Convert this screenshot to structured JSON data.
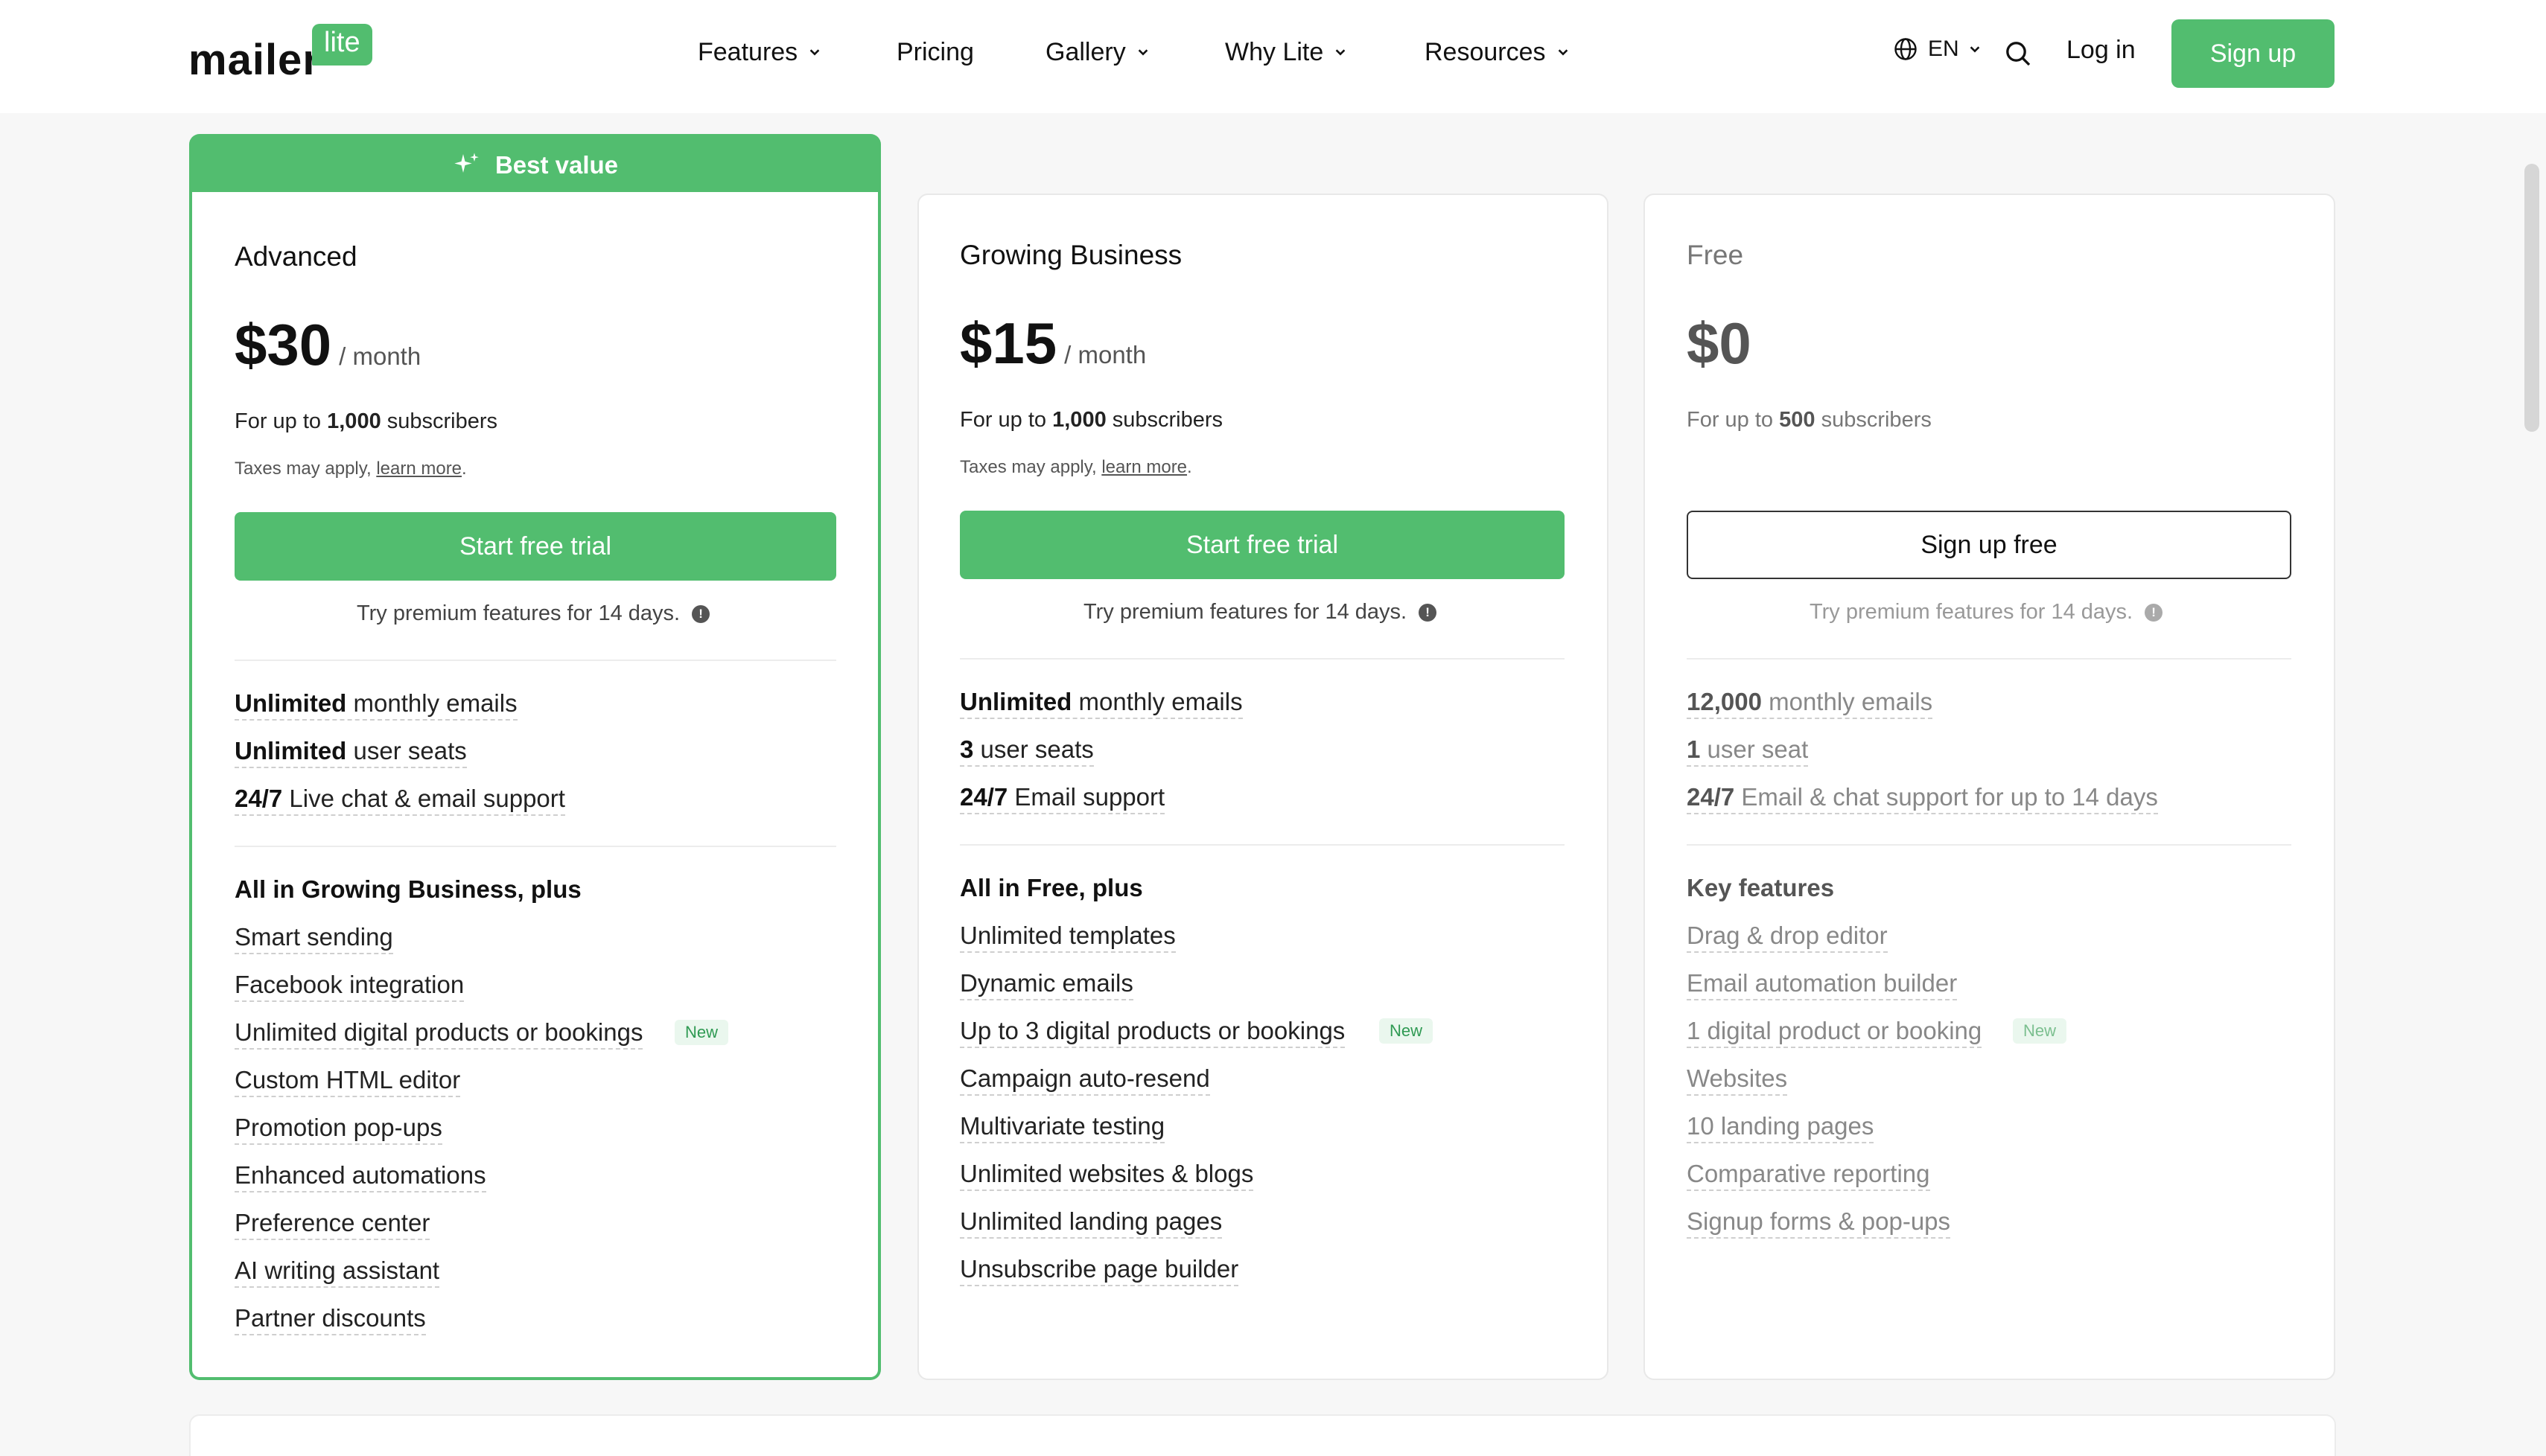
{
  "header": {
    "logo_main": "mailer",
    "logo_badge": "lite",
    "nav": [
      {
        "label": "Features",
        "dropdown": true
      },
      {
        "label": "Pricing",
        "dropdown": false
      },
      {
        "label": "Gallery",
        "dropdown": true
      },
      {
        "label": "Why Lite",
        "dropdown": true
      },
      {
        "label": "Resources",
        "dropdown": true
      }
    ],
    "language": "EN",
    "login": "Log in",
    "signup": "Sign up"
  },
  "colors": {
    "accent": "#52bd6f",
    "text": "#111111",
    "muted": "#777777"
  },
  "plans": [
    {
      "badge": "Best value",
      "name": "Advanced",
      "price": "$30",
      "per": "/ month",
      "subs_prefix": "For up to",
      "subs_count": "1,000",
      "subs_suffix": "subscribers",
      "taxes": "Taxes may apply,",
      "taxes_link": "learn more",
      "cta": "Start free trial",
      "trial_note": "Try premium features for 14 days.",
      "core": [
        {
          "bold": "Unlimited",
          "text": "monthly emails"
        },
        {
          "bold": "Unlimited",
          "text": "user seats"
        },
        {
          "bold": "24/7",
          "text": "Live chat & email support"
        }
      ],
      "group_title": "All in Growing Business, plus",
      "features": [
        "Smart sending",
        "Facebook integration",
        "Unlimited digital products or bookings",
        "Custom HTML editor",
        "Promotion pop-ups",
        "Enhanced automations",
        "Preference center",
        "AI writing assistant",
        "Partner discounts"
      ],
      "new_label": "New"
    },
    {
      "name": "Growing Business",
      "price": "$15",
      "per": "/ month",
      "subs_prefix": "For up to",
      "subs_count": "1,000",
      "subs_suffix": "subscribers",
      "taxes": "Taxes may apply,",
      "taxes_link": "learn more",
      "cta": "Start free trial",
      "trial_note": "Try premium features for 14 days.",
      "core": [
        {
          "bold": "Unlimited",
          "text": "monthly emails"
        },
        {
          "bold": "3",
          "text": "user seats"
        },
        {
          "bold": "24/7",
          "text": "Email support"
        }
      ],
      "group_title": "All in Free, plus",
      "features": [
        "Unlimited templates",
        "Dynamic emails",
        "Up to 3 digital products or bookings",
        "Campaign auto-resend",
        "Multivariate testing",
        "Unlimited websites & blogs",
        "Unlimited landing pages",
        "Unsubscribe page builder"
      ],
      "new_label": "New"
    },
    {
      "name": "Free",
      "price": "$0",
      "subs_prefix": "For up to",
      "subs_count": "500",
      "subs_suffix": "subscribers",
      "cta": "Sign up free",
      "trial_note": "Try premium features for 14 days.",
      "core": [
        {
          "bold": "12,000",
          "text": "monthly emails"
        },
        {
          "bold": "1",
          "text": "user seat"
        },
        {
          "bold": "24/7",
          "text": "Email & chat support for up to 14 days"
        }
      ],
      "group_title": "Key features",
      "features": [
        "Drag & drop editor",
        "Email automation builder",
        "1 digital product or booking",
        "Websites",
        "10 landing pages",
        "Comparative reporting",
        "Signup forms & pop-ups"
      ],
      "new_label": "New"
    }
  ]
}
